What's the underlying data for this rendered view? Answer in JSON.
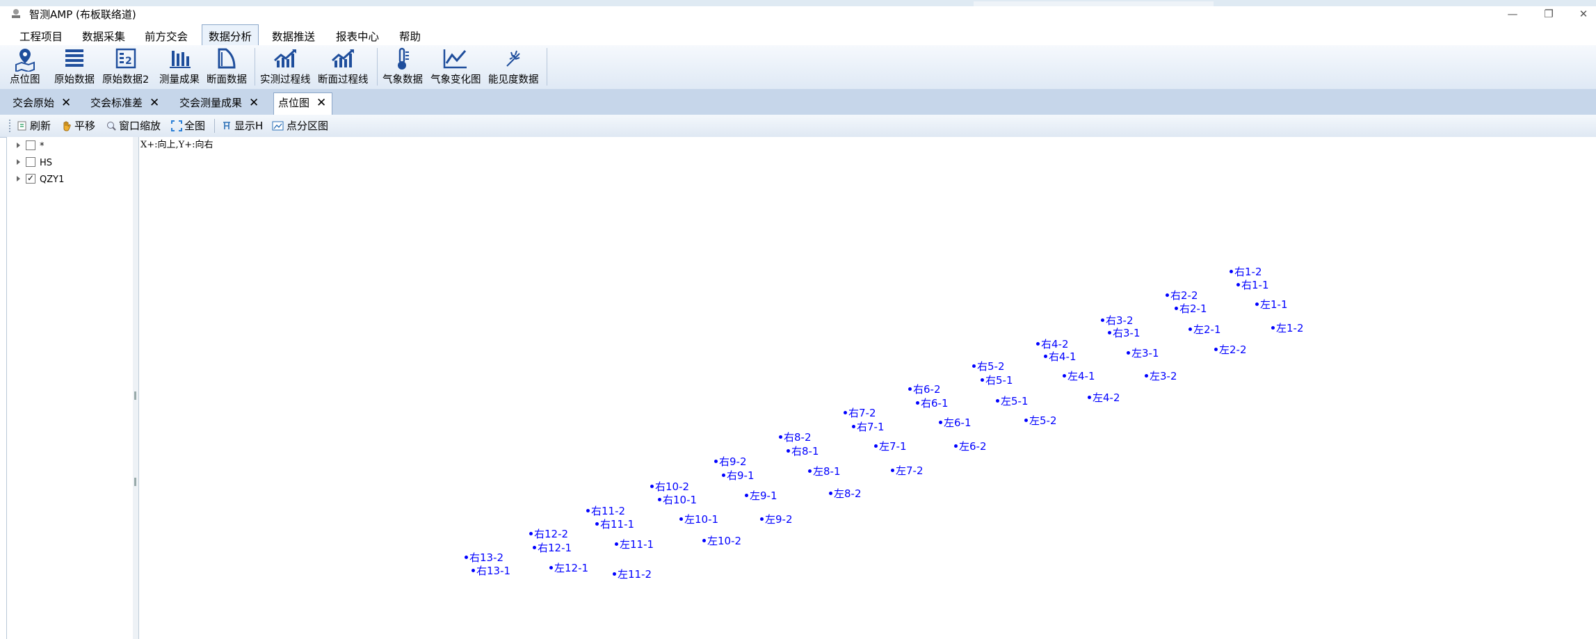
{
  "window": {
    "title": "智测AMP (布板联络道)",
    "controls": [
      "—",
      "❐",
      "✕"
    ]
  },
  "menu": [
    {
      "label": "工程项目",
      "active": false
    },
    {
      "label": "数据采集",
      "active": false
    },
    {
      "label": "前方交会",
      "active": false
    },
    {
      "label": "数据分析",
      "active": true
    },
    {
      "label": "数据推送",
      "active": false
    },
    {
      "label": "报表中心",
      "active": false
    },
    {
      "label": "帮助",
      "active": false
    }
  ],
  "ribbon": [
    {
      "label": "点位图",
      "icon": "map-pin-icon"
    },
    {
      "label": "原始数据",
      "icon": "list-icon"
    },
    {
      "label": "原始数据2",
      "icon": "list-2-icon"
    },
    {
      "label": "测量成果",
      "icon": "bar-chart-icon"
    },
    {
      "label": "断面数据",
      "icon": "section-icon"
    },
    {
      "label": "实测过程线",
      "icon": "trend-chart-icon"
    },
    {
      "label": "断面过程线",
      "icon": "trend-chart-2-icon"
    },
    {
      "label": "气象数据",
      "icon": "thermometer-icon"
    },
    {
      "label": "气象变化图",
      "icon": "line-chart-icon"
    },
    {
      "label": "能见度数据",
      "icon": "visibility-icon"
    }
  ],
  "tabs": [
    {
      "label": "交会原始",
      "active": false
    },
    {
      "label": "交会标准差",
      "active": false
    },
    {
      "label": "交会测量成果",
      "active": false
    },
    {
      "label": "点位图",
      "active": true
    }
  ],
  "toolbar": {
    "refresh": "刷新",
    "pan": "平移",
    "window_zoom": "窗口缩放",
    "full_view": "全图",
    "show_h": "显示H",
    "zone_map": "点分区图"
  },
  "tree": [
    {
      "label": "*",
      "checked": false
    },
    {
      "label": "HS",
      "checked": false
    },
    {
      "label": "QZY1",
      "checked": true
    }
  ],
  "canvas": {
    "axis_note": "X+:向上,Y+:向右"
  },
  "points": [
    "右1-2",
    "右1-1",
    "左1-1",
    "左1-2",
    "右2-2",
    "右2-1",
    "左2-1",
    "左2-2",
    "右3-2",
    "右3-1",
    "左3-1",
    "左3-2",
    "右4-2",
    "右4-1",
    "左4-1",
    "左4-2",
    "右5-2",
    "右5-1",
    "左5-1",
    "左5-2",
    "右6-2",
    "右6-1",
    "左6-1",
    "左6-2",
    "右7-2",
    "右7-1",
    "左7-1",
    "左7-2",
    "右8-2",
    "右8-1",
    "左8-1",
    "左8-2",
    "右9-2",
    "右9-1",
    "左9-1",
    "左9-2",
    "右10-2",
    "右10-1",
    "左10-1",
    "左10-2",
    "右11-2",
    "右11-1",
    "左11-1",
    "左11-2",
    "右12-2",
    "右12-1",
    "左12-1",
    "右13-2",
    "右13-1"
  ],
  "colors": {
    "point": "#0000ff",
    "ribbon_icon": "#1f4e9c"
  }
}
